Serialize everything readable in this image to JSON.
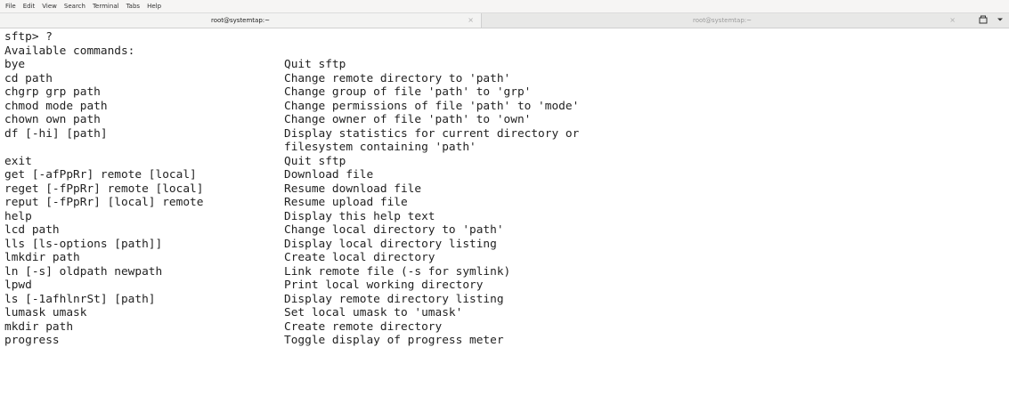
{
  "menu": [
    "File",
    "Edit",
    "View",
    "Search",
    "Terminal",
    "Tabs",
    "Help"
  ],
  "tabs": [
    {
      "title": "root@systemtap:~",
      "close": "×"
    },
    {
      "title": "root@systemtap:~",
      "close": "×"
    }
  ],
  "tab_tools": {
    "add_tab_icon": "new-tab-icon",
    "menu_icon": "dropdown-icon"
  },
  "terminal": {
    "prompt_line": "sftp> ?",
    "header_line": "Available commands:",
    "rows": [
      {
        "cmd": "bye",
        "desc": "Quit sftp"
      },
      {
        "cmd": "cd path",
        "desc": "Change remote directory to 'path'"
      },
      {
        "cmd": "chgrp grp path",
        "desc": "Change group of file 'path' to 'grp'"
      },
      {
        "cmd": "chmod mode path",
        "desc": "Change permissions of file 'path' to 'mode'"
      },
      {
        "cmd": "chown own path",
        "desc": "Change owner of file 'path' to 'own'"
      },
      {
        "cmd": "df [-hi] [path]",
        "desc": "Display statistics for current directory or"
      },
      {
        "cmd": "",
        "desc": "filesystem containing 'path'"
      },
      {
        "cmd": "exit",
        "desc": "Quit sftp"
      },
      {
        "cmd": "get [-afPpRr] remote [local]",
        "desc": "Download file"
      },
      {
        "cmd": "reget [-fPpRr] remote [local]",
        "desc": "Resume download file"
      },
      {
        "cmd": "reput [-fPpRr] [local] remote",
        "desc": "Resume upload file"
      },
      {
        "cmd": "help",
        "desc": "Display this help text"
      },
      {
        "cmd": "lcd path",
        "desc": "Change local directory to 'path'"
      },
      {
        "cmd": "lls [ls-options [path]]",
        "desc": "Display local directory listing"
      },
      {
        "cmd": "lmkdir path",
        "desc": "Create local directory"
      },
      {
        "cmd": "ln [-s] oldpath newpath",
        "desc": "Link remote file (-s for symlink)"
      },
      {
        "cmd": "lpwd",
        "desc": "Print local working directory"
      },
      {
        "cmd": "ls [-1afhlnrSt] [path]",
        "desc": "Display remote directory listing"
      },
      {
        "cmd": "lumask umask",
        "desc": "Set local umask to 'umask'"
      },
      {
        "cmd": "mkdir path",
        "desc": "Create remote directory"
      },
      {
        "cmd": "progress",
        "desc": "Toggle display of progress meter"
      }
    ]
  }
}
